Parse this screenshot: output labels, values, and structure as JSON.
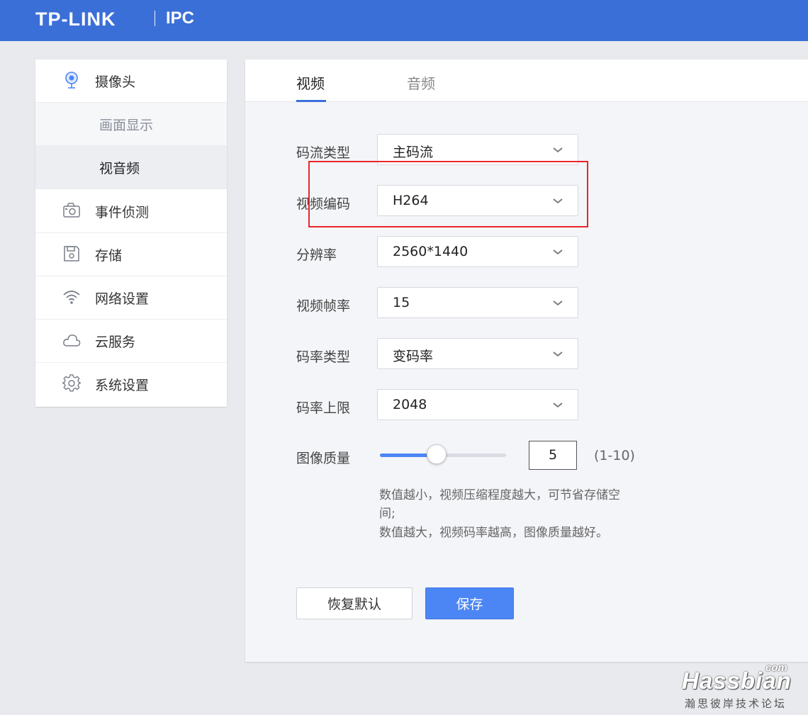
{
  "header": {
    "brand": "TP-LINK",
    "product": "IPC",
    "bg_color": "#3b6fd8"
  },
  "sidebar": {
    "camera_label": "摄像头",
    "sub_items": [
      {
        "label": "画面显示",
        "active": false
      },
      {
        "label": "视音频",
        "active": true
      }
    ],
    "items": [
      {
        "label": "事件侦测",
        "icon": "event-camera-icon"
      },
      {
        "label": "存储",
        "icon": "storage-icon"
      },
      {
        "label": "网络设置",
        "icon": "wifi-icon"
      },
      {
        "label": "云服务",
        "icon": "cloud-icon"
      },
      {
        "label": "系统设置",
        "icon": "gear-icon"
      }
    ]
  },
  "tabs": [
    {
      "label": "视频",
      "active": true
    },
    {
      "label": "音频",
      "active": false
    }
  ],
  "form": {
    "fields": [
      {
        "label": "码流类型",
        "value": "主码流"
      },
      {
        "label": "视频编码",
        "value": "H264"
      },
      {
        "label": "分辨率",
        "value": "2560*1440"
      },
      {
        "label": "视频帧率",
        "value": "15"
      },
      {
        "label": "码率类型",
        "value": "变码率"
      },
      {
        "label": "码率上限",
        "value": "2048"
      }
    ],
    "quality": {
      "label": "图像质量",
      "value": "5",
      "range_text": "(1-10)",
      "fraction": 0.45,
      "hint_lines": [
        "数值越小，视频压缩程度越大，可节省存储空",
        "间;",
        "数值越大，视频码率越高，图像质量越好。"
      ]
    }
  },
  "buttons": {
    "reset": "恢复默认",
    "save": "保存"
  },
  "accent_color": "#4c86f5",
  "highlight_color": "#e8262b",
  "watermark": {
    "main": "Hassbian",
    "suffix": "com",
    "subtitle": "瀚思彼岸技术论坛"
  }
}
